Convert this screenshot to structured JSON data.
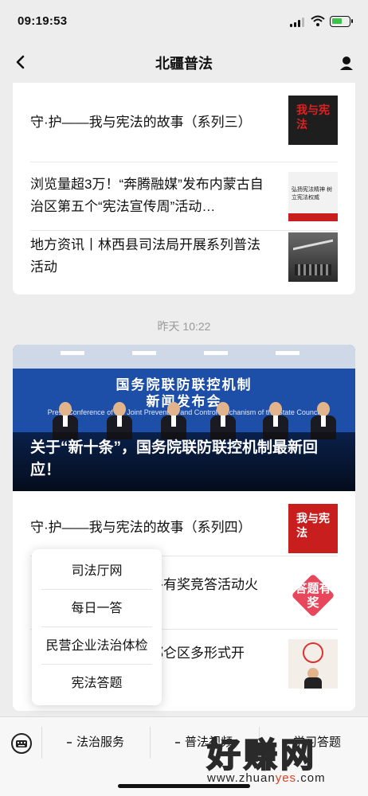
{
  "status_bar": {
    "time": "09:19:53"
  },
  "nav": {
    "title": "北疆普法"
  },
  "card1": {
    "items": [
      {
        "title": "守·护——我与宪法的故事（系列三）",
        "thumb": "我与宪法"
      },
      {
        "title": "浏览量超3万！“奔腾融媒”发布内蒙古自治区第五个“宪法宣传周”活动…",
        "thumb": "弘扬宪法精神 树立宪法权威"
      },
      {
        "title": "地方资讯丨林西县司法局开展系列普法活动",
        "thumb": ""
      }
    ]
  },
  "timestamp": "昨天 10:22",
  "card2": {
    "hero": {
      "banner_line1": "国务院联防联控机制",
      "banner_line2": "新闻发布会",
      "banner_sub": "Press Conference of the Joint Prevention and Control Mechanism of the State Council",
      "caption": "关于“新十条”，国务院联防联控机制最新回应！"
    },
    "items": [
      {
        "title": "守·护——我与宪法的故事（系列四）",
        "thumb": "我与宪法"
      },
      {
        "title": "各有奖竞答活动火",
        "thumb": "答题有奖"
      },
      {
        "title": "都仑区多形式开",
        "thumb": ""
      }
    ]
  },
  "popup": {
    "items": [
      "司法厅网",
      "每日一答",
      "民营企业法治体检",
      "宪法答题"
    ]
  },
  "bottom_menu": {
    "items": [
      "法治服务",
      "普法视频",
      "学习答题"
    ]
  },
  "watermark": {
    "title": "好赚网",
    "url_a": "www.zhuan",
    "url_b": "yes",
    "url_c": ".com"
  },
  "colors": {
    "hero_blue": "#1d4fa8",
    "thumb_red": "#c81e1e"
  }
}
